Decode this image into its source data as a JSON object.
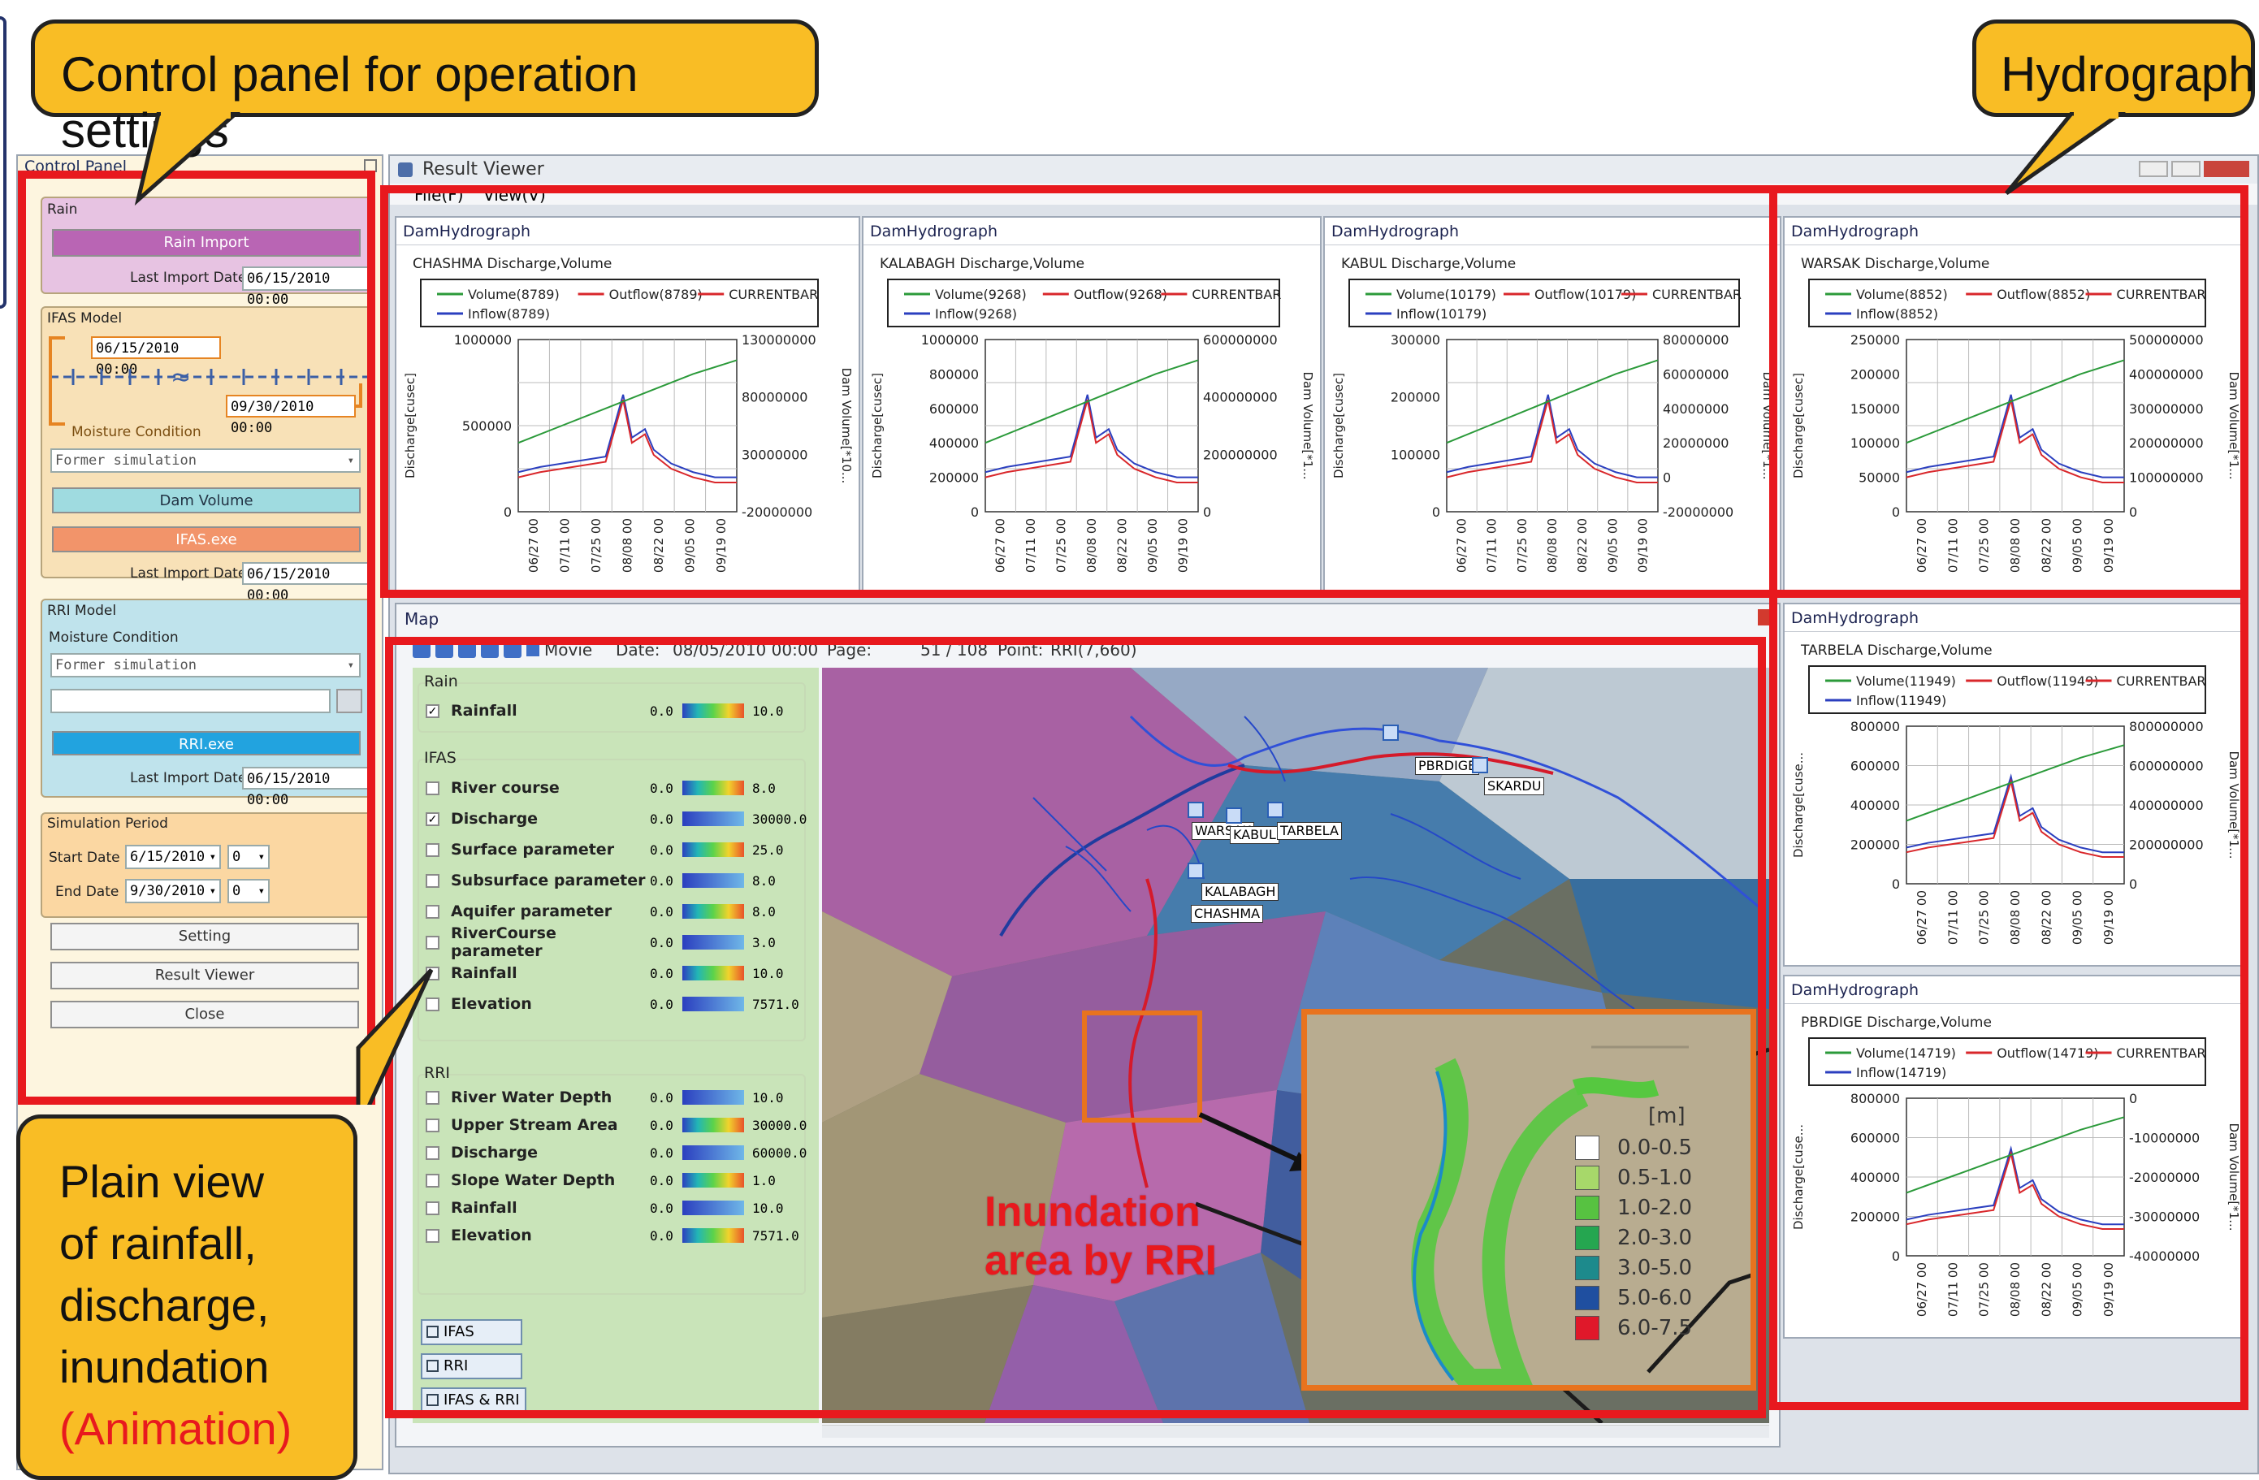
{
  "callouts": {
    "control": "Control panel for operation settings",
    "hydrograph": "Hydrograph",
    "plain": [
      "Plain view",
      "of rainfall,",
      "discharge,",
      "inundation"
    ],
    "animation": "(Animation)"
  },
  "control_panel": {
    "title": "Control Panel",
    "rain": {
      "section": "Rain",
      "import_button": "Rain Import",
      "last_import_label": "Last Import Date",
      "last_import_value": "06/15/2010 00:00"
    },
    "ifas": {
      "section": "IFAS Model",
      "start": "06/15/2010 00:00",
      "end": "09/30/2010 00:00",
      "moisture_label": "Moisture Condition",
      "moisture_value": "Former simulation",
      "dam_button": "Dam Volume",
      "exe_button": "IFAS.exe",
      "last_import_label": "Last Import Date",
      "last_import_value": "06/15/2010 00:00"
    },
    "rri": {
      "section": "RRI Model",
      "moisture_label": "Moisture Condition",
      "moisture_value": "Former simulation",
      "exe_button": "RRI.exe",
      "last_import_label": "Last Import Date",
      "last_import_value": "06/15/2010 00:00"
    },
    "period": {
      "section": "Simulation Period",
      "start_label": "Start Date",
      "start_value": "6/15/2010",
      "start_hour": "0",
      "end_label": "End Date",
      "end_value": "9/30/2010",
      "end_hour": "0"
    },
    "buttons": {
      "setting": "Setting",
      "result": "Result Viewer",
      "close": "Close"
    }
  },
  "result_viewer": {
    "title": "Result Viewer",
    "menu_file": "File(F)",
    "menu_view": "View(V)"
  },
  "hydrographs": [
    {
      "header": "DamHydrograph",
      "title": "CHASHMA Discharge,Volume",
      "vol": "Volume(8789)",
      "out": "Outflow(8789)",
      "cur": "CURRENTBAR",
      "inf": "Inflow(8789)",
      "yl": [
        "1000000",
        "500000",
        "0"
      ],
      "yr": [
        "130000000",
        "80000000",
        "30000000",
        "-20000000"
      ],
      "ylab": "Discharge[cusec]",
      "rlab": "Dam Volume[*10..."
    },
    {
      "header": "DamHydrograph",
      "title": "KALABAGH Discharge,Volume",
      "vol": "Volume(9268)",
      "out": "Outflow(9268)",
      "cur": "CURRENTBAR",
      "inf": "Inflow(9268)",
      "yl": [
        "1000000",
        "800000",
        "600000",
        "400000",
        "200000",
        "0"
      ],
      "yr": [
        "600000000",
        "400000000",
        "200000000",
        "0"
      ],
      "ylab": "Discharge[cusec]",
      "rlab": "Dam Volume[*1..."
    },
    {
      "header": "DamHydrograph",
      "title": "KABUL Discharge,Volume",
      "vol": "Volume(10179)",
      "out": "Outflow(10179)",
      "cur": "CURRENTBAR",
      "inf": "Inflow(10179)",
      "yl": [
        "300000",
        "200000",
        "100000",
        "0"
      ],
      "yr": [
        "80000000",
        "60000000",
        "40000000",
        "20000000",
        "0",
        "-20000000"
      ],
      "ylab": "Discharge[cusec]",
      "rlab": "Dam Volume[*1..."
    },
    {
      "header": "DamHydrograph",
      "title": "WARSAK Discharge,Volume",
      "vol": "Volume(8852)",
      "out": "Outflow(8852)",
      "cur": "CURRENTBAR",
      "inf": "Inflow(8852)",
      "yl": [
        "250000",
        "200000",
        "150000",
        "100000",
        "50000",
        "0"
      ],
      "yr": [
        "500000000",
        "400000000",
        "300000000",
        "200000000",
        "100000000",
        "0"
      ],
      "ylab": "Discharge[cusec]",
      "rlab": "Dam Volume[*1..."
    },
    {
      "header": "DamHydrograph",
      "title": "TARBELA Discharge,Volume",
      "vol": "Volume(11949)",
      "out": "Outflow(11949)",
      "cur": "CURRENTBAR",
      "inf": "Inflow(11949)",
      "yl": [
        "800000",
        "600000",
        "400000",
        "200000",
        "0"
      ],
      "yr": [
        "800000000",
        "600000000",
        "400000000",
        "200000000",
        "0"
      ],
      "ylab": "Discharge[cuse...",
      "rlab": "Dam Volume[*1..."
    },
    {
      "header": "DamHydrograph",
      "title": "PBRDIGE Discharge,Volume",
      "vol": "Volume(14719)",
      "out": "Outflow(14719)",
      "cur": "CURRENTBAR",
      "inf": "Inflow(14719)",
      "yl": [
        "800000",
        "600000",
        "400000",
        "200000",
        "0"
      ],
      "yr": [
        "0",
        "-10000000",
        "-20000000",
        "-30000000",
        "-40000000"
      ],
      "ylab": "Discharge[cuse...",
      "rlab": "Dam Volume[*1..."
    }
  ],
  "x_ticks": [
    "06/27 00",
    "07/11 00",
    "07/25 00",
    "08/08 00",
    "08/22 00",
    "09/05 00",
    "09/19 00"
  ],
  "map": {
    "title": "Map",
    "movie": "Movie",
    "date_label": "Date:",
    "date_value": "08/05/2010 00:00",
    "page_label": "Page:",
    "page_value": "51 / 108",
    "point_label": "Point:",
    "point_value": "RRI(7,660)",
    "groups": {
      "rain": "Rain",
      "ifas": "IFAS",
      "rri": "RRI"
    },
    "rain_layers": [
      {
        "label": "Rainfall",
        "min": "0.0",
        "max": "10.0",
        "checked": true
      }
    ],
    "ifas_layers": [
      {
        "label": "River course",
        "min": "0.0",
        "max": "8.0",
        "checked": false
      },
      {
        "label": "Discharge",
        "min": "0.0",
        "max": "30000.0",
        "checked": true
      },
      {
        "label": "Surface parameter",
        "min": "0.0",
        "max": "25.0",
        "checked": false
      },
      {
        "label": "Subsurface parameter",
        "min": "0.0",
        "max": "8.0",
        "checked": false
      },
      {
        "label": "Aquifer parameter",
        "min": "0.0",
        "max": "8.0",
        "checked": false
      },
      {
        "label": "RiverCourse parameter",
        "min": "0.0",
        "max": "3.0",
        "checked": false
      },
      {
        "label": "Rainfall",
        "min": "0.0",
        "max": "10.0",
        "checked": false
      },
      {
        "label": "Elevation",
        "min": "0.0",
        "max": "7571.0",
        "checked": false
      }
    ],
    "rri_layers": [
      {
        "label": "River Water Depth",
        "min": "0.0",
        "max": "10.0",
        "checked": false
      },
      {
        "label": "Upper Stream Area",
        "min": "0.0",
        "max": "30000.0",
        "checked": false
      },
      {
        "label": "Discharge",
        "min": "0.0",
        "max": "60000.0",
        "checked": false
      },
      {
        "label": "Slope Water Depth",
        "min": "0.0",
        "max": "1.0",
        "checked": false
      },
      {
        "label": "Rainfall",
        "min": "0.0",
        "max": "10.0",
        "checked": false
      },
      {
        "label": "Elevation",
        "min": "0.0",
        "max": "7571.0",
        "checked": false
      }
    ],
    "mode_buttons": [
      "IFAS",
      "RRI",
      "IFAS & RRI"
    ],
    "places": [
      "PBRDIGE",
      "SKARDU",
      "WARSAK",
      "KABUL",
      "TARBELA",
      "KALABAGH",
      "CHASHMA"
    ],
    "inundation_label": [
      "Inundation",
      "area  by RRI"
    ],
    "scale_unit": "[m]",
    "scale": [
      {
        "label": "0.0-0.5",
        "color": "#ffffff"
      },
      {
        "label": "0.5-1.0",
        "color": "#a7d86a"
      },
      {
        "label": "1.0-2.0",
        "color": "#57c241"
      },
      {
        "label": "2.0-3.0",
        "color": "#25a650"
      },
      {
        "label": "3.0-5.0",
        "color": "#1d8a8c"
      },
      {
        "label": "5.0-6.0",
        "color": "#1f4fa0"
      },
      {
        "label": "6.0-7.5",
        "color": "#e0182a"
      }
    ]
  },
  "colors": {
    "highlight": "#e8191e",
    "callout": "#f9bd25",
    "volume": "#2b9a3a",
    "inflow": "#2b3fbf",
    "outflow": "#d9272b"
  }
}
